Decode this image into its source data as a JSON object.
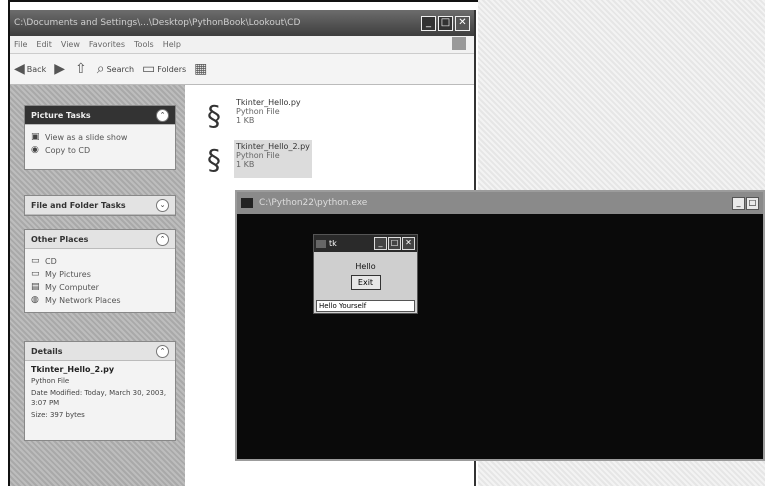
{
  "explorer": {
    "title": "C:\\Documents and Settings\\...\\Desktop\\PythonBook\\Lookout\\CD",
    "menu": [
      "File",
      "Edit",
      "View",
      "Favorites",
      "Tools",
      "Help"
    ],
    "toolbar": {
      "back": "Back",
      "search": "Search",
      "folders": "Folders"
    }
  },
  "sidebar": {
    "picture_tasks": {
      "title": "Picture Tasks",
      "items": [
        {
          "icon": "slideshow-icon",
          "label": "View as a slide show"
        },
        {
          "icon": "cd-icon",
          "label": "Copy to CD"
        }
      ]
    },
    "file_folder_tasks": {
      "title": "File and Folder Tasks"
    },
    "other_places": {
      "title": "Other Places",
      "items": [
        {
          "icon": "folder-icon",
          "label": "CD"
        },
        {
          "icon": "folder-icon",
          "label": "My Pictures"
        },
        {
          "icon": "computer-icon",
          "label": "My Computer"
        },
        {
          "icon": "network-icon",
          "label": "My Network Places"
        }
      ]
    },
    "details": {
      "title": "Details",
      "name": "Tkinter_Hello_2.py",
      "type": "Python File",
      "modified": "Date Modified: Today, March 30, 2003, 3:07 PM",
      "size": "Size: 397 bytes"
    }
  },
  "files": [
    {
      "name": "Tkinter_Hello.py",
      "type": "Python File",
      "size": "1 KB"
    },
    {
      "name": "Tkinter_Hello_2.py",
      "type": "Python File",
      "size": "1 KB"
    }
  ],
  "console": {
    "title": "C:\\Python22\\python.exe"
  },
  "tk": {
    "title": "tk",
    "label": "Hello",
    "exit_label": "Exit",
    "entry_value": "Hello Yourself"
  }
}
